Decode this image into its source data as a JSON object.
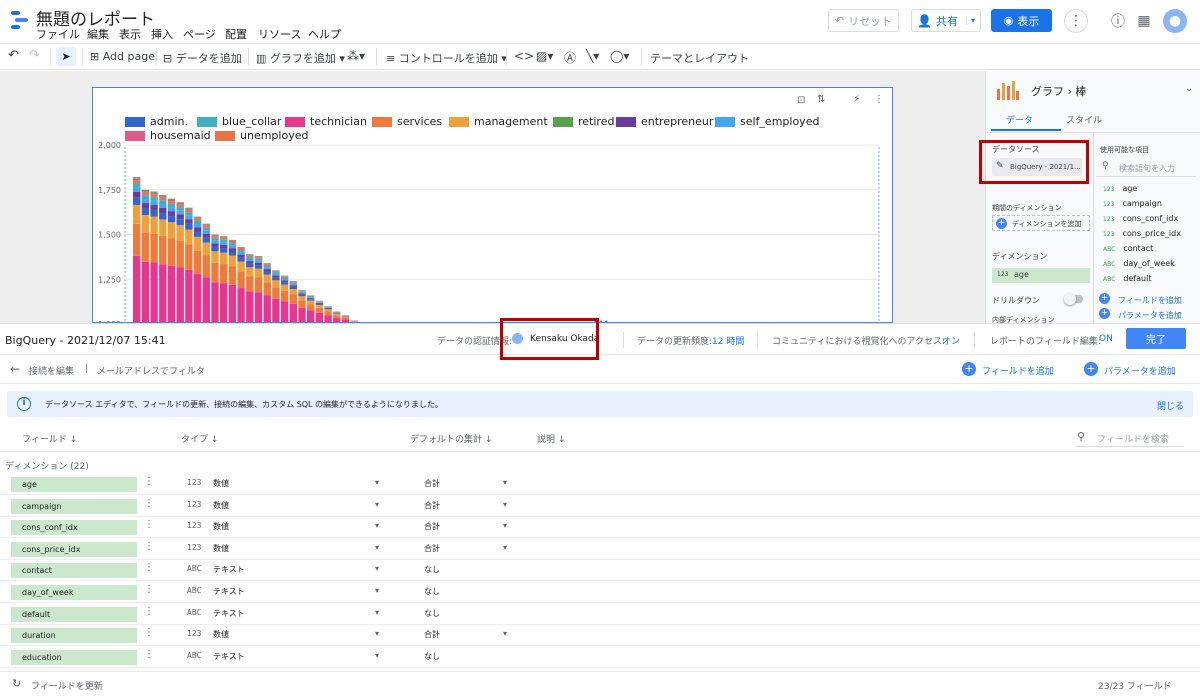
{
  "app": {
    "title": "無題のレポート",
    "menu": [
      "ファイル",
      "編集",
      "表示",
      "挿入",
      "ページ",
      "配置",
      "リソース",
      "ヘルプ"
    ],
    "reset_label": "リセット",
    "share_label": "共有",
    "view_label": "表示"
  },
  "toolbar": {
    "add_page": "Add page",
    "add_data": "データを追加",
    "add_chart": "グラフを追加",
    "add_control": "コントロールを追加",
    "theme_layout": "テーマとレイアウト"
  },
  "chart_data": {
    "type": "bar",
    "series": [
      {
        "name": "admin."
      },
      {
        "name": "blue_collar"
      },
      {
        "name": "technician"
      },
      {
        "name": "services"
      },
      {
        "name": "management"
      },
      {
        "name": "retired"
      },
      {
        "name": "entrepreneur"
      },
      {
        "name": "self_employed"
      },
      {
        "name": "housemaid"
      },
      {
        "name": "unemployed"
      }
    ],
    "colors": [
      "#3366cc",
      "#3fb0c0",
      "#e8368f",
      "#f07a3a",
      "#f0a03a",
      "#59a14f",
      "#6a3d9a",
      "#42a5f5",
      "#e15a8c",
      "#e8744a"
    ],
    "y_ticks": [
      "2,000",
      "1,750",
      "1,500",
      "1,250",
      "1,000"
    ],
    "ylim": [
      1000,
      2000
    ],
    "totals": [
      1820,
      1750,
      1740,
      1720,
      1700,
      1680,
      1650,
      1600,
      1560,
      1500,
      1490,
      1470,
      1430,
      1390,
      1380,
      1340,
      1300,
      1270,
      1240,
      1190,
      1160,
      1130,
      1100,
      1070,
      1050,
      1020
    ]
  },
  "right_panel": {
    "header": "グラフ",
    "chart_kind": "棒",
    "tab_data": "データ",
    "tab_style": "スタイル",
    "data_source_label": "データソース",
    "data_source_value": "BigQuery - 2021/1...",
    "date_dimension_label": "期間のディメンション",
    "add_dimension": "ディメンションを追加",
    "dimension_label": "ディメンション",
    "dimension_value": "age",
    "drilldown_label": "ドリルダウン",
    "internal_dimension": "内部ディメンション",
    "available_fields": "使用可能な項目",
    "search_placeholder": "検索語句を入力",
    "fields": [
      "age",
      "campaign",
      "cons_conf_idx",
      "cons_price_idx",
      "contact",
      "day_of_week",
      "default"
    ],
    "field_types": [
      "123",
      "123",
      "123",
      "123",
      "ABC",
      "ABC",
      "ABC"
    ],
    "add_field": "フィールドを追加",
    "add_parameter": "パラメータを追加"
  },
  "datasource": {
    "name": "BigQuery - 2021/12/07 15:41",
    "credential_label": "データの認証情報:",
    "credential_user": "Kensaku Okada",
    "refresh_label": "データの更新頻度:",
    "refresh_value": "12 時間",
    "community_label": "コミュニティにおける視覚化へのアクセス:",
    "community_value": "オン",
    "field_edit_label": "レポートのフィールド編集:",
    "field_edit_value": "ON",
    "done": "完了",
    "edit_connection": "接続を編集",
    "filter_by_email": "メールアドレスでフィルタ",
    "add_field": "フィールドを追加",
    "add_parameter": "パラメータを追加",
    "info_message": "データソース エディタで、フィールドの更新、接続の編集、カスタム SQL の編集ができるようになりました。",
    "close": "閉じる",
    "col_field": "フィールド",
    "col_type": "タイプ",
    "col_default_agg": "デフォルトの集計",
    "col_description": "説明",
    "search_fields_placeholder": "フィールドを検索",
    "section_dimensions": "ディメンション (22)",
    "rows": [
      {
        "name": "age",
        "type_icon": "123",
        "type": "数値",
        "agg": "合計"
      },
      {
        "name": "campaign",
        "type_icon": "123",
        "type": "数値",
        "agg": "合計"
      },
      {
        "name": "cons_conf_idx",
        "type_icon": "123",
        "type": "数値",
        "agg": "合計"
      },
      {
        "name": "cons_price_idx",
        "type_icon": "123",
        "type": "数値",
        "agg": "合計"
      },
      {
        "name": "contact",
        "type_icon": "ABC",
        "type": "テキスト",
        "agg": "なし"
      },
      {
        "name": "day_of_week",
        "type_icon": "ABC",
        "type": "テキスト",
        "agg": "なし"
      },
      {
        "name": "default",
        "type_icon": "ABC",
        "type": "テキスト",
        "agg": "なし"
      },
      {
        "name": "duration",
        "type_icon": "123",
        "type": "数値",
        "agg": "合計"
      },
      {
        "name": "education",
        "type_icon": "ABC",
        "type": "テキスト",
        "agg": "なし"
      }
    ],
    "refresh_fields": "フィールドを更新",
    "field_count": "23/23 フィールド"
  }
}
